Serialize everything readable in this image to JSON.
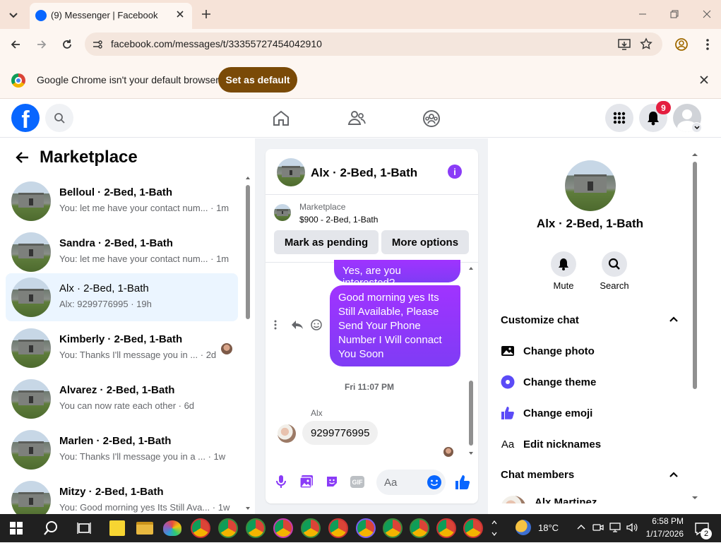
{
  "browser": {
    "tab_title": "(9) Messenger | Facebook",
    "url": "facebook.com/messages/t/33355727454042910",
    "infobar_text": "Google Chrome isn't your default browser",
    "set_default_label": "Set as default"
  },
  "fb": {
    "notification_count": "9"
  },
  "left": {
    "title": "Marketplace",
    "conversations": [
      {
        "name": "Belloul · 2-Bed, 1-Bath",
        "snippet": "You: let me have your contact num... · 1m",
        "selected": false
      },
      {
        "name": "Sandra · 2-Bed, 1-Bath",
        "snippet": "You: let me have your contact num... · 1m",
        "selected": false
      },
      {
        "name": "Alx · 2-Bed, 1-Bath",
        "snippet": "Alx: 9299776995 · 19h",
        "selected": true
      },
      {
        "name": "Kimberly · 2-Bed, 1-Bath",
        "snippet": "You: Thanks I'll message you in ... · 2d",
        "selected": false
      },
      {
        "name": "Alvarez · 2-Bed, 1-Bath",
        "snippet": "You can now rate each other · 6d",
        "selected": false
      },
      {
        "name": "Marlen · 2-Bed, 1-Bath",
        "snippet": "You: Thanks I'll message you in a ... · 1w",
        "selected": false
      },
      {
        "name": "Mitzy · 2-Bed, 1-Bath",
        "snippet": "You: Good morning yes Its Still Ava... · 1w",
        "selected": false
      }
    ]
  },
  "chat": {
    "title": "Alx · 2-Bed, 1-Bath",
    "listing_source": "Marketplace",
    "listing_price": "$900 - 2-Bed, 1-Bath",
    "mark_pending_label": "Mark as pending",
    "more_options_label": "More options",
    "messages": {
      "out1": "Yes, are you interested?",
      "out2": "Good morning yes Its Still Available, Please Send Your Phone Number I Will connact You Soon",
      "timestamp": "Fri 11:07 PM",
      "in_sender": "Alx",
      "in1": "9299776995"
    },
    "composer_placeholder": "Aa"
  },
  "right": {
    "title": "Alx · 2-Bed, 1-Bath",
    "mute_label": "Mute",
    "search_label": "Search",
    "customize_label": "Customize chat",
    "options": [
      "Change photo",
      "Change theme",
      "Change emoji",
      "Edit nicknames"
    ],
    "members_label": "Chat members",
    "member_name": "Alx Martinez"
  },
  "taskbar": {
    "temperature": "18°C",
    "time": "6:58 PM",
    "date": "1/17/2026",
    "notification_badge": "2"
  },
  "colors": {
    "accent_purple": "#8a3cf7",
    "fb_blue": "#0866ff",
    "set_default_bg": "#7a4a07",
    "selected_row": "#ebf5ff"
  }
}
